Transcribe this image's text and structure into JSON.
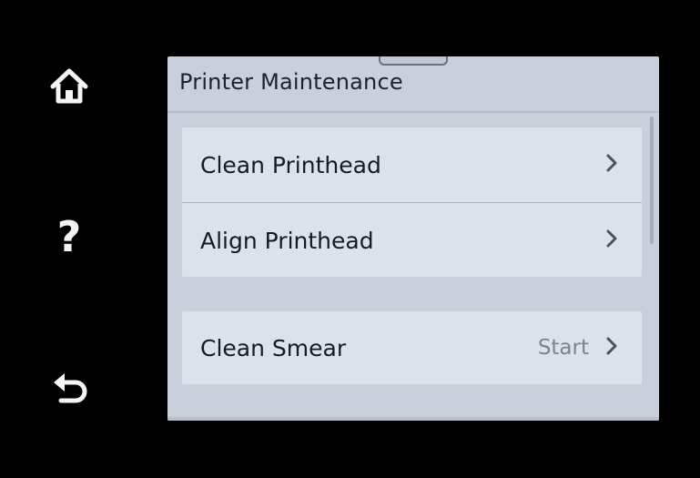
{
  "screen": {
    "title": "Printer Maintenance"
  },
  "side_buttons": {
    "home_icon": "home-icon",
    "help_icon": "question-icon",
    "help_glyph": "?",
    "back_icon": "back-arrow-icon"
  },
  "menu": {
    "items": [
      {
        "label": "Clean Printhead",
        "value": "",
        "icon": "chevron-right-icon"
      },
      {
        "label": "Align Printhead",
        "value": "",
        "icon": "chevron-right-icon"
      },
      {
        "label": "Clean Smear",
        "value": "Start",
        "icon": "chevron-right-icon"
      }
    ]
  },
  "colors": {
    "bezel": "#000000",
    "screen_background": "#c9d0dc",
    "list_background": "#dde2ea",
    "text_primary": "#151a26",
    "text_secondary": "#7c8391"
  }
}
